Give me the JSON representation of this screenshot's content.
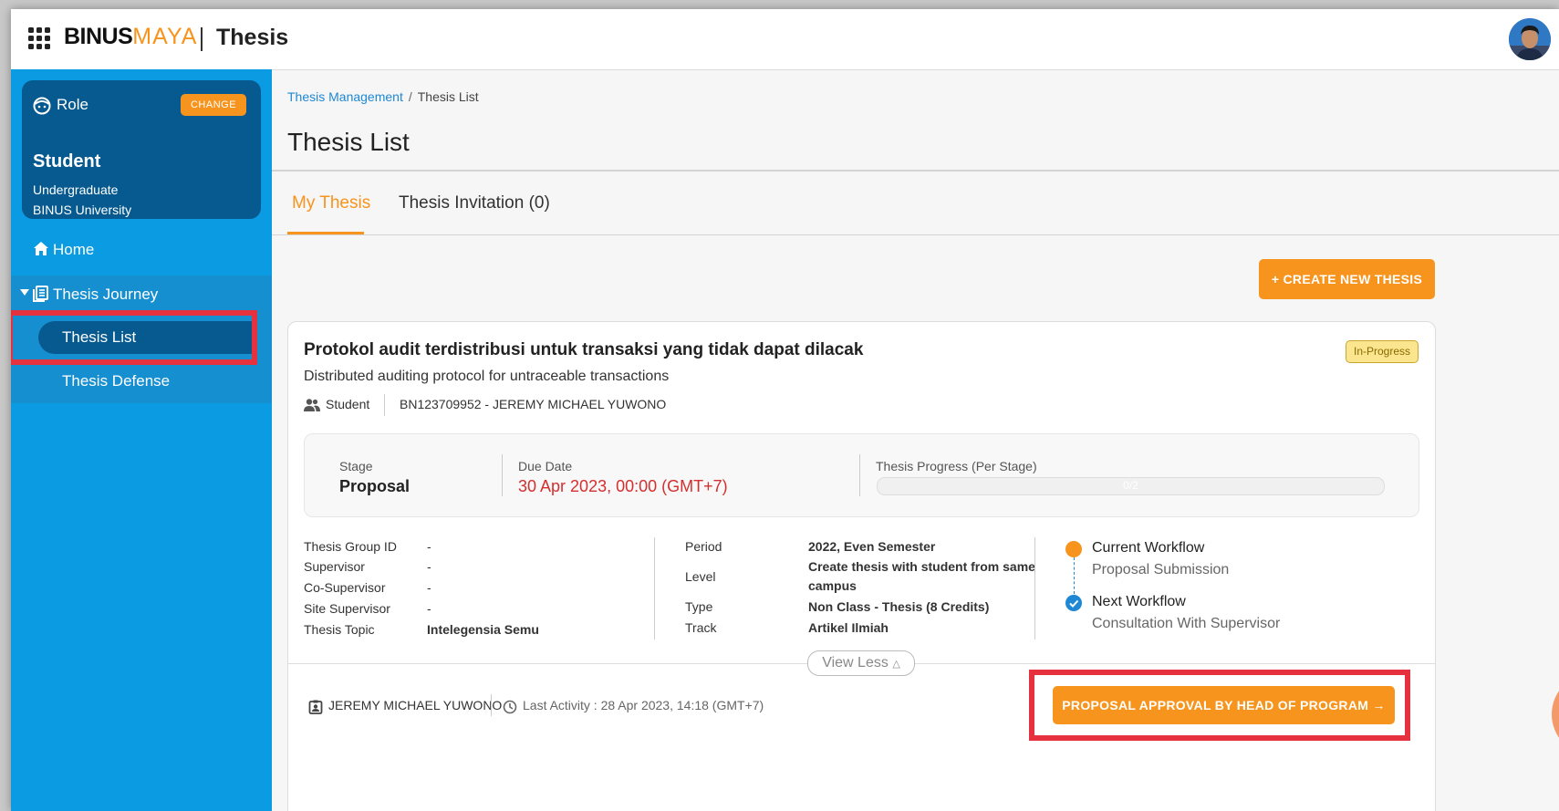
{
  "header": {
    "logo_main": "BINUS",
    "logo_accent": "MAYA",
    "app_title": "Thesis"
  },
  "sidebar": {
    "role_label": "Role",
    "change_label": "CHANGE",
    "role_name": "Student",
    "role_level": "Undergraduate",
    "role_institution": "BINUS University",
    "home_label": "Home",
    "journey_label": "Thesis Journey",
    "list_label": "Thesis List",
    "defense_label": "Thesis Defense"
  },
  "breadcrumb": {
    "parent": "Thesis Management",
    "separator": "/",
    "current": "Thesis List"
  },
  "page_title": "Thesis List",
  "tabs": {
    "my_thesis": "My Thesis",
    "invitation": "Thesis Invitation (0)"
  },
  "create_button": "+ CREATE NEW THESIS",
  "thesis": {
    "title": "Protokol audit terdistribusi untuk transaksi yang tidak dapat dilacak",
    "subtitle": "Distributed auditing protocol for untraceable transactions",
    "status": "In-Progress",
    "student_label": "Student",
    "student_value": "BN123709952 - JEREMY MICHAEL YUWONO",
    "stage_label": "Stage",
    "stage_value": "Proposal",
    "due_label": "Due Date",
    "due_value": "30 Apr 2023, 00:00 (GMT+7)",
    "progress_label": "Thesis Progress (Per Stage)",
    "progress_text": "0/2",
    "progress_fraction": 0,
    "group_id_label": "Thesis Group ID",
    "group_id_value": "-",
    "supervisor_label": "Supervisor",
    "supervisor_value": "-",
    "cosupervisor_label": "Co-Supervisor",
    "cosupervisor_value": "-",
    "site_supervisor_label": "Site Supervisor",
    "site_supervisor_value": "-",
    "topic_label": "Thesis Topic",
    "topic_value": "Intelegensia Semu",
    "period_label": "Period",
    "period_value": "2022, Even Semester",
    "level_label": "Level",
    "level_value_line1": "Create thesis with student from same",
    "level_value_line2": "campus",
    "type_label": "Type",
    "type_value": "Non Class - Thesis (8 Credits)",
    "track_label": "Track",
    "track_value": "Artikel Ilmiah",
    "current_workflow_label": "Current Workflow",
    "current_workflow_value": "Proposal Submission",
    "next_workflow_label": "Next Workflow",
    "next_workflow_value": "Consultation With Supervisor",
    "view_less": "View Less",
    "owner": "JEREMY MICHAEL YUWONO",
    "last_activity": "Last Activity : 28 Apr 2023, 14:18 (GMT+7)",
    "action_button": "PROPOSAL APPROVAL BY HEAD OF PROGRAM →"
  },
  "colors": {
    "primary_blue": "#0b9be3",
    "dark_blue": "#065a8f",
    "accent_orange": "#f7941d",
    "due_red": "#d32f2f",
    "highlight_red": "#e6323f"
  }
}
